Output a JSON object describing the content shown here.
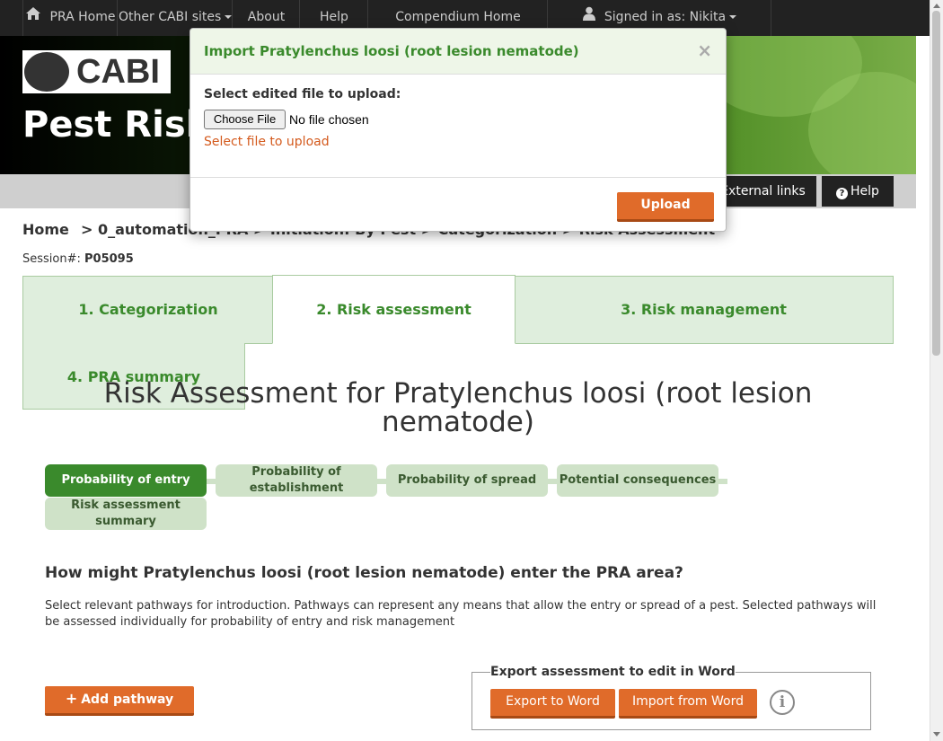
{
  "topnav": {
    "items": [
      {
        "label": "PRA Home",
        "icon": "home-icon"
      },
      {
        "label": "Other CABI sites"
      },
      {
        "label": "About"
      },
      {
        "label": "Help"
      },
      {
        "label": "Compendium Home"
      },
      {
        "label": "Signed in as: Nikita",
        "icon": "user-icon"
      }
    ]
  },
  "banner": {
    "logo_text": "CABI",
    "title": "Pest Risk Analysis Tool"
  },
  "subnav": {
    "external_links": "External links",
    "help": "Help"
  },
  "breadcrumb": {
    "home": "Home",
    "items": "> 0_automation_PRA  >  Initiation: By Pest  >  Categorization  >  Risk Assessment"
  },
  "session": {
    "label": "Session#:",
    "value": "P05095"
  },
  "tabs": [
    {
      "label": "1. Categorization",
      "active": false
    },
    {
      "label": "2. Risk assessment",
      "active": true
    },
    {
      "label": "3. Risk management",
      "active": false
    },
    {
      "label": "4. PRA summary",
      "active": false
    }
  ],
  "main": {
    "title": "Risk Assessment for Pratylenchus loosi (root lesion nematode)",
    "steps": [
      {
        "label": "Probability of entry",
        "active": true
      },
      {
        "label": "Probability of establishment",
        "active": false
      },
      {
        "label": "Probability of spread",
        "active": false
      },
      {
        "label": "Potential consequences",
        "active": false
      },
      {
        "label": "Risk assessment summary",
        "active": false
      }
    ],
    "question": "How might Pratylenchus loosi (root lesion nematode) enter the PRA area?",
    "help_text": "Select relevant pathways for introduction. Pathways can represent any means that allow the entry or spread of a pest. Selected pathways will be assessed individually for probability of entry and risk management",
    "add_pathway": "Add pathway",
    "export_legend": "Export assessment to edit in Word",
    "export_button": "Export to Word",
    "import_button": "Import from Word"
  },
  "modal": {
    "title": "Import Pratylenchus loosi (root lesion nematode)",
    "close": "×",
    "label": "Select edited file to upload:",
    "file_button": "Choose File",
    "file_status": "No file chosen",
    "error": "Select file to upload",
    "upload_button": "Upload"
  },
  "colors": {
    "accent_green": "#3a8a2c",
    "orange": "#e06b2a",
    "nav_dark": "#222222"
  }
}
